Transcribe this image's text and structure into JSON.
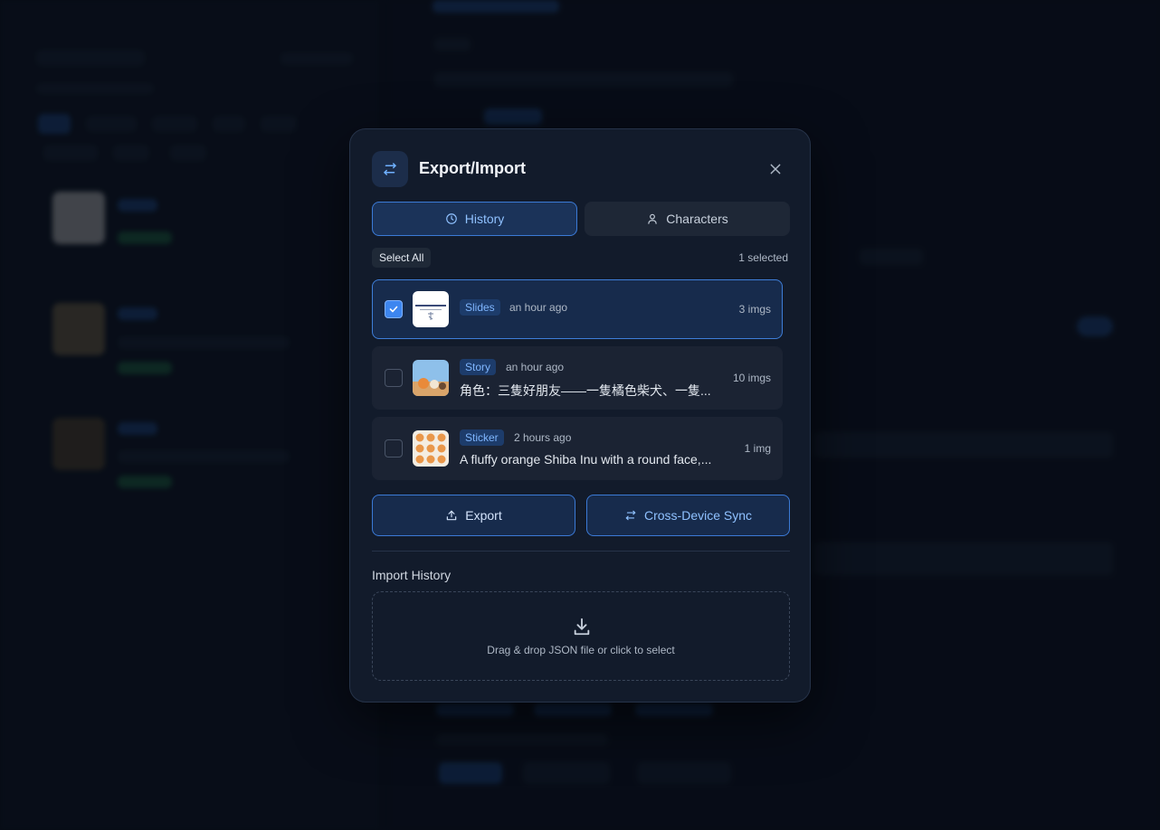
{
  "modal": {
    "title": "Export/Import",
    "tabs": [
      {
        "label": "History",
        "icon": "clock-icon",
        "active": true
      },
      {
        "label": "Characters",
        "icon": "user-icon",
        "active": false
      }
    ],
    "select_all_label": "Select All",
    "selected_count": "1 selected",
    "items": [
      {
        "tag": "Slides",
        "time": "an hour ago",
        "description": "",
        "count": "3 imgs",
        "checked": true
      },
      {
        "tag": "Story",
        "time": "an hour ago",
        "description": "角色：三隻好朋友——一隻橘色柴犬、一隻...",
        "count": "10 imgs",
        "checked": false
      },
      {
        "tag": "Sticker",
        "time": "2 hours ago",
        "description": "A fluffy orange Shiba Inu with a round face,...",
        "count": "1 img",
        "checked": false
      }
    ],
    "export_label": "Export",
    "sync_label": "Cross-Device Sync",
    "import_heading": "Import History",
    "dropzone_text": "Drag & drop JSON file or click to select"
  },
  "colors": {
    "accent": "#3d86f0",
    "accent_text": "#8fc1ff",
    "modal_bg": "#121b2b",
    "page_bg": "#0a101c"
  }
}
